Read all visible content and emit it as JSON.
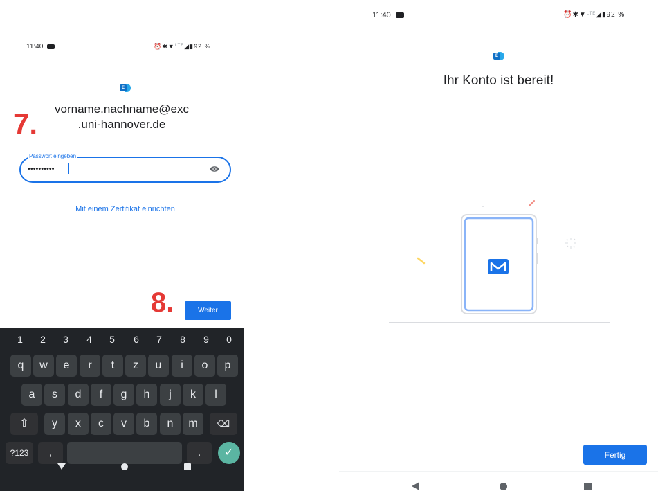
{
  "left_screen": {
    "status_bar": {
      "time": "11:40",
      "battery": "92 %",
      "network": "LTE"
    },
    "account_email_line1": "vorname.nachname@exc",
    "account_email_line2": ".uni-hannover.de",
    "step_marker_7": "7.",
    "password_field": {
      "label": "Passwort eingeben",
      "value": "••••••••••"
    },
    "certificate_link": "Mit einem Zertifikat einrichten",
    "step_marker_8": "8.",
    "next_button": "Weiter",
    "keyboard": {
      "number_row": [
        "1",
        "2",
        "3",
        "4",
        "5",
        "6",
        "7",
        "8",
        "9",
        "0"
      ],
      "row1": [
        "q",
        "w",
        "e",
        "r",
        "t",
        "z",
        "u",
        "i",
        "o",
        "p"
      ],
      "row2": [
        "a",
        "s",
        "d",
        "f",
        "g",
        "h",
        "j",
        "k",
        "l"
      ],
      "row3": [
        "y",
        "x",
        "c",
        "v",
        "b",
        "n",
        "m"
      ],
      "symbols_key": "?123",
      "comma_key": ",",
      "period_key": "."
    }
  },
  "right_screen": {
    "status_bar": {
      "time": "11:40",
      "battery": "92 %",
      "network": "LTE"
    },
    "title": "Ihr Konto ist bereit!",
    "done_button": "Fertig"
  },
  "colors": {
    "accent": "#1a73e8",
    "marker_red": "#e53935",
    "keyboard_bg": "#212428",
    "key_bg": "#3c4043",
    "done_key": "#5bb5a2",
    "exchange_dark": "#0f6fc6",
    "exchange_light": "#28a8ea"
  },
  "icons": [
    "exchange-logo-icon",
    "eye-icon",
    "shift-icon",
    "backspace-icon",
    "checkmark-icon",
    "back-icon",
    "home-icon",
    "recents-icon",
    "mail-icon",
    "alarm-icon",
    "bluetooth-icon",
    "wifi-icon",
    "signal-icon",
    "battery-icon",
    "camera-notification-icon"
  ]
}
